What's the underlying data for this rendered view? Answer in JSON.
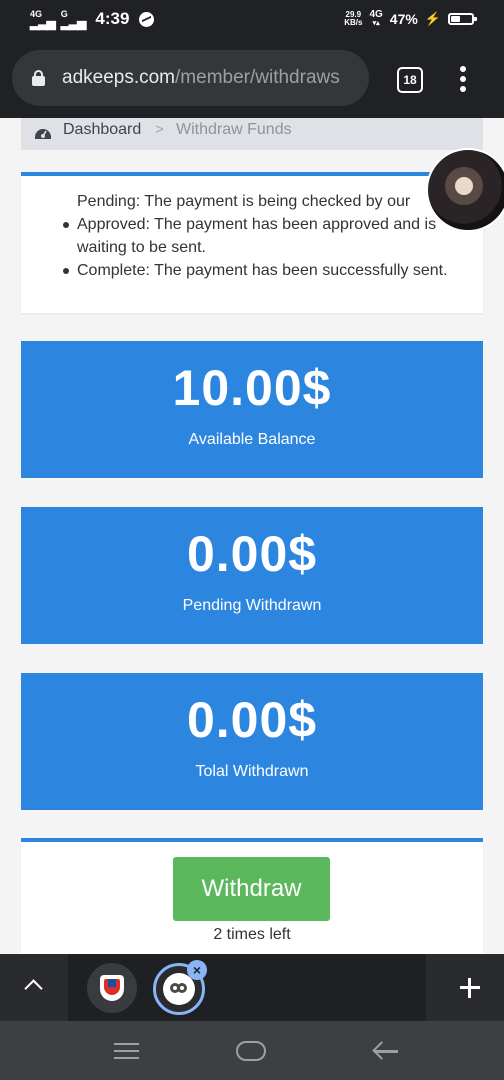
{
  "status_bar": {
    "signal1_label": "4G",
    "signal2_label": "G",
    "time": "4:39",
    "net_speed_value": "29.9",
    "net_speed_unit": "KB/s",
    "net_type": "4G",
    "battery_percent": "47%",
    "icons": [
      "signal-icon",
      "messenger-icon",
      "volte-icon",
      "charging-icon",
      "battery-icon"
    ]
  },
  "browser": {
    "url_domain": "adkeeps.com",
    "url_path": "/member/withdraws",
    "tab_count": "18",
    "icons": [
      "lock-icon",
      "tabs-icon",
      "menu-icon"
    ]
  },
  "breadcrumb": {
    "home": "Dashboard",
    "separator": ">",
    "current": "Withdraw Funds"
  },
  "status_info": {
    "items": [
      "Pending: The payment is being checked by our",
      "Approved: The payment has been approved and is waiting to be sent.",
      "Complete: The payment has been successfully sent."
    ]
  },
  "stats": [
    {
      "amount": "10.00$",
      "label": "Available Balance"
    },
    {
      "amount": "0.00$",
      "label": "Pending Withdrawn"
    },
    {
      "amount": "0.00$",
      "label": "Tolal Withdrawn"
    }
  ],
  "withdraw": {
    "button_label": "Withdraw",
    "times_left": "2 times left"
  },
  "tab_strip": {
    "close_glyph": "×",
    "icons": [
      "chevron-up-icon",
      "shield-favicon-icon",
      "link-favicon-icon",
      "close-icon",
      "plus-icon"
    ]
  },
  "nav_bar": {
    "icons": [
      "recents-icon",
      "home-icon",
      "back-icon"
    ]
  },
  "colors": {
    "accent_blue": "#2c86e0",
    "withdraw_green": "#5cb85c",
    "browser_dark": "#202124"
  }
}
